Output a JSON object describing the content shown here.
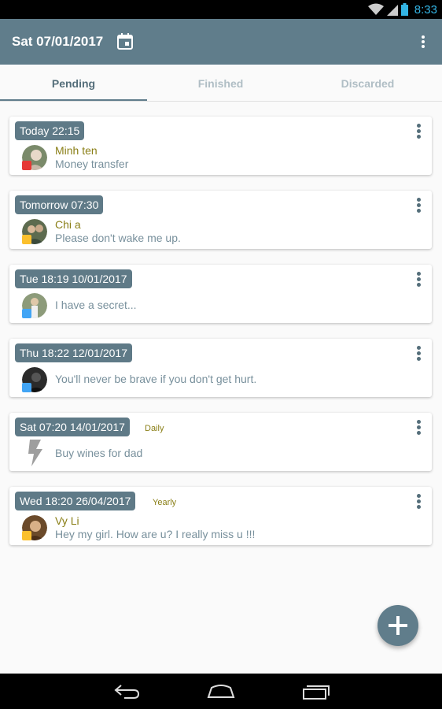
{
  "status_bar": {
    "time": "8:33"
  },
  "app_bar": {
    "title": "Sat 07/01/2017"
  },
  "tabs": [
    {
      "label": "Pending",
      "active": true
    },
    {
      "label": "Finished",
      "active": false
    },
    {
      "label": "Discarded",
      "active": false
    }
  ],
  "reminders": [
    {
      "date": "Today 22:15",
      "repeat": "",
      "name": "Minh ten",
      "message": "Money transfer",
      "avatar_color": "#7a8a6a",
      "badge_color": "#e53935"
    },
    {
      "date": "Tomorrow 07:30",
      "repeat": "",
      "name": "Chi a",
      "message": "Please don't wake me up.",
      "avatar_color": "#5d6b4f",
      "badge_color": "#fbc02d"
    },
    {
      "date": "Tue 18:19 10/01/2017",
      "repeat": "",
      "name": "",
      "message": "I have a secret...",
      "avatar_color": "#8d9b7a",
      "badge_color": "#42a5f5"
    },
    {
      "date": "Thu 18:22 12/01/2017",
      "repeat": "",
      "name": "",
      "message": "You'll never be brave if you don't get hurt.",
      "avatar_color": "#2b2b2b",
      "badge_color": "#42a5f5"
    },
    {
      "date": "Sat 07:20 14/01/2017",
      "repeat": "Daily",
      "name": "",
      "message": "Buy wines for dad",
      "icon": "lightning-bolt-icon"
    },
    {
      "date": "Wed 18:20 26/04/2017",
      "repeat": "Yearly",
      "name": "Vy Li",
      "message": "Hey my girl. How are u? I really miss u !!!",
      "avatar_color": "#6b4a2a",
      "badge_color": "#fbc02d"
    }
  ],
  "colors": {
    "primary": "#607d8b",
    "accent_text": "#8a7f17",
    "secondary_text": "#78909c"
  }
}
